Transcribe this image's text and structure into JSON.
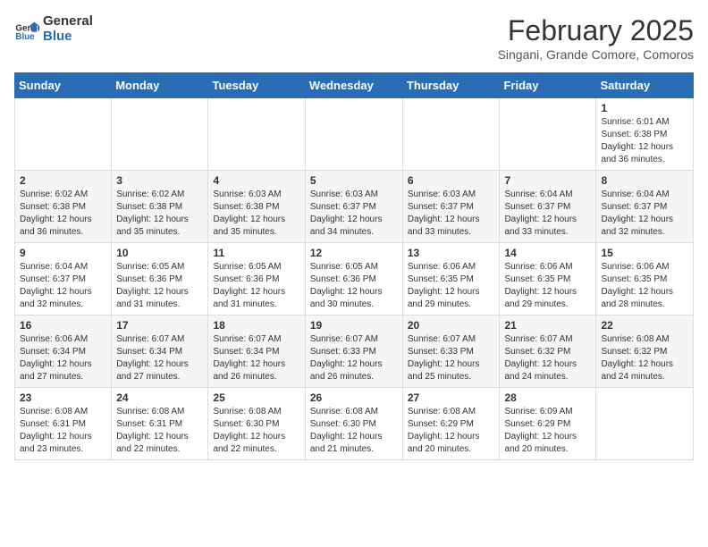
{
  "logo": {
    "line1": "General",
    "line2": "Blue"
  },
  "title": "February 2025",
  "subtitle": "Singani, Grande Comore, Comoros",
  "days_of_week": [
    "Sunday",
    "Monday",
    "Tuesday",
    "Wednesday",
    "Thursday",
    "Friday",
    "Saturday"
  ],
  "weeks": [
    [
      {
        "day": "",
        "content": ""
      },
      {
        "day": "",
        "content": ""
      },
      {
        "day": "",
        "content": ""
      },
      {
        "day": "",
        "content": ""
      },
      {
        "day": "",
        "content": ""
      },
      {
        "day": "",
        "content": ""
      },
      {
        "day": "1",
        "content": "Sunrise: 6:01 AM\nSunset: 6:38 PM\nDaylight: 12 hours\nand 36 minutes."
      }
    ],
    [
      {
        "day": "2",
        "content": "Sunrise: 6:02 AM\nSunset: 6:38 PM\nDaylight: 12 hours\nand 36 minutes."
      },
      {
        "day": "3",
        "content": "Sunrise: 6:02 AM\nSunset: 6:38 PM\nDaylight: 12 hours\nand 35 minutes."
      },
      {
        "day": "4",
        "content": "Sunrise: 6:03 AM\nSunset: 6:38 PM\nDaylight: 12 hours\nand 35 minutes."
      },
      {
        "day": "5",
        "content": "Sunrise: 6:03 AM\nSunset: 6:37 PM\nDaylight: 12 hours\nand 34 minutes."
      },
      {
        "day": "6",
        "content": "Sunrise: 6:03 AM\nSunset: 6:37 PM\nDaylight: 12 hours\nand 33 minutes."
      },
      {
        "day": "7",
        "content": "Sunrise: 6:04 AM\nSunset: 6:37 PM\nDaylight: 12 hours\nand 33 minutes."
      },
      {
        "day": "8",
        "content": "Sunrise: 6:04 AM\nSunset: 6:37 PM\nDaylight: 12 hours\nand 32 minutes."
      }
    ],
    [
      {
        "day": "9",
        "content": "Sunrise: 6:04 AM\nSunset: 6:37 PM\nDaylight: 12 hours\nand 32 minutes."
      },
      {
        "day": "10",
        "content": "Sunrise: 6:05 AM\nSunset: 6:36 PM\nDaylight: 12 hours\nand 31 minutes."
      },
      {
        "day": "11",
        "content": "Sunrise: 6:05 AM\nSunset: 6:36 PM\nDaylight: 12 hours\nand 31 minutes."
      },
      {
        "day": "12",
        "content": "Sunrise: 6:05 AM\nSunset: 6:36 PM\nDaylight: 12 hours\nand 30 minutes."
      },
      {
        "day": "13",
        "content": "Sunrise: 6:06 AM\nSunset: 6:35 PM\nDaylight: 12 hours\nand 29 minutes."
      },
      {
        "day": "14",
        "content": "Sunrise: 6:06 AM\nSunset: 6:35 PM\nDaylight: 12 hours\nand 29 minutes."
      },
      {
        "day": "15",
        "content": "Sunrise: 6:06 AM\nSunset: 6:35 PM\nDaylight: 12 hours\nand 28 minutes."
      }
    ],
    [
      {
        "day": "16",
        "content": "Sunrise: 6:06 AM\nSunset: 6:34 PM\nDaylight: 12 hours\nand 27 minutes."
      },
      {
        "day": "17",
        "content": "Sunrise: 6:07 AM\nSunset: 6:34 PM\nDaylight: 12 hours\nand 27 minutes."
      },
      {
        "day": "18",
        "content": "Sunrise: 6:07 AM\nSunset: 6:34 PM\nDaylight: 12 hours\nand 26 minutes."
      },
      {
        "day": "19",
        "content": "Sunrise: 6:07 AM\nSunset: 6:33 PM\nDaylight: 12 hours\nand 26 minutes."
      },
      {
        "day": "20",
        "content": "Sunrise: 6:07 AM\nSunset: 6:33 PM\nDaylight: 12 hours\nand 25 minutes."
      },
      {
        "day": "21",
        "content": "Sunrise: 6:07 AM\nSunset: 6:32 PM\nDaylight: 12 hours\nand 24 minutes."
      },
      {
        "day": "22",
        "content": "Sunrise: 6:08 AM\nSunset: 6:32 PM\nDaylight: 12 hours\nand 24 minutes."
      }
    ],
    [
      {
        "day": "23",
        "content": "Sunrise: 6:08 AM\nSunset: 6:31 PM\nDaylight: 12 hours\nand 23 minutes."
      },
      {
        "day": "24",
        "content": "Sunrise: 6:08 AM\nSunset: 6:31 PM\nDaylight: 12 hours\nand 22 minutes."
      },
      {
        "day": "25",
        "content": "Sunrise: 6:08 AM\nSunset: 6:30 PM\nDaylight: 12 hours\nand 22 minutes."
      },
      {
        "day": "26",
        "content": "Sunrise: 6:08 AM\nSunset: 6:30 PM\nDaylight: 12 hours\nand 21 minutes."
      },
      {
        "day": "27",
        "content": "Sunrise: 6:08 AM\nSunset: 6:29 PM\nDaylight: 12 hours\nand 20 minutes."
      },
      {
        "day": "28",
        "content": "Sunrise: 6:09 AM\nSunset: 6:29 PM\nDaylight: 12 hours\nand 20 minutes."
      },
      {
        "day": "",
        "content": ""
      }
    ]
  ]
}
